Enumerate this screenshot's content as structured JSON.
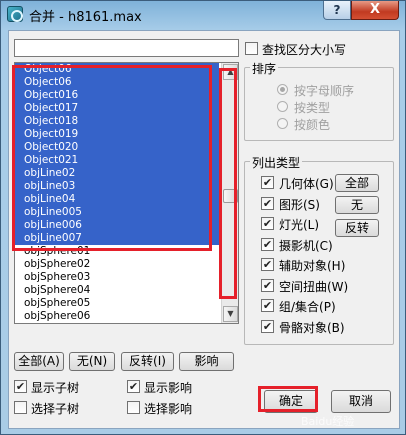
{
  "window": {
    "title": "合并 - h8161.max",
    "help_label": "?",
    "close_label": "X"
  },
  "filter": {
    "value": ""
  },
  "list": {
    "items": [
      {
        "label": "Object06",
        "selected": true
      },
      {
        "label": "Object06",
        "selected": true
      },
      {
        "label": "Object016",
        "selected": true
      },
      {
        "label": "Object017",
        "selected": true
      },
      {
        "label": "Object018",
        "selected": true
      },
      {
        "label": "Object019",
        "selected": true
      },
      {
        "label": "Object020",
        "selected": true
      },
      {
        "label": "Object021",
        "selected": true
      },
      {
        "label": "objLine02",
        "selected": true
      },
      {
        "label": "objLine03",
        "selected": true
      },
      {
        "label": "objLine04",
        "selected": true
      },
      {
        "label": "objLine005",
        "selected": true
      },
      {
        "label": "objLine006",
        "selected": true
      },
      {
        "label": "objLine007",
        "selected": true
      },
      {
        "label": "objSphere01",
        "selected": false
      },
      {
        "label": "objSphere02",
        "selected": false
      },
      {
        "label": "objSphere03",
        "selected": false
      },
      {
        "label": "objSphere04",
        "selected": false
      },
      {
        "label": "objSphere05",
        "selected": false
      },
      {
        "label": "objSphere06",
        "selected": false
      }
    ],
    "scroll_up": "▲",
    "scroll_down": "▼"
  },
  "bottom_buttons": {
    "all": "全部(A)",
    "none": "无(N)",
    "invert": "反转(I)",
    "influence": "影响"
  },
  "options": {
    "show_subtree": {
      "label": "显示子树",
      "checked": true
    },
    "show_influence": {
      "label": "显示影响",
      "checked": true
    },
    "select_subtree": {
      "label": "选择子树",
      "checked": false
    },
    "select_influence": {
      "label": "选择影响",
      "checked": false
    }
  },
  "case_sensitive": {
    "label": "查找区分大小写",
    "checked": false
  },
  "sort": {
    "title": "排序",
    "options": [
      {
        "label": "按字母顺序",
        "selected": true
      },
      {
        "label": "按类型",
        "selected": false
      },
      {
        "label": "按颜色",
        "selected": false
      }
    ]
  },
  "types": {
    "title": "列出类型",
    "items": [
      {
        "label": "几何体(G)",
        "checked": true
      },
      {
        "label": "图形(S)",
        "checked": true
      },
      {
        "label": "灯光(L)",
        "checked": true
      },
      {
        "label": "摄影机(C)",
        "checked": true
      },
      {
        "label": "辅助对象(H)",
        "checked": true
      },
      {
        "label": "空间扭曲(W)",
        "checked": true
      },
      {
        "label": "组/集合(P)",
        "checked": true
      },
      {
        "label": "骨骼对象(B)",
        "checked": true
      }
    ],
    "all_label": "全部",
    "none_label": "无",
    "invert_label": "反转"
  },
  "dialog": {
    "ok_label": "确定",
    "cancel_label": "取消"
  },
  "check_mark": "✔",
  "watermark": "Baidu经验"
}
